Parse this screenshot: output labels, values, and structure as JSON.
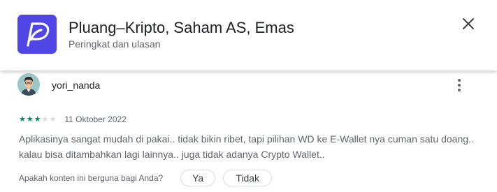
{
  "header": {
    "app_name": "Pluang–Kripto, Saham AS, Emas",
    "subtitle": "Peringkat dan ulasan",
    "icon": "pluang-logo-icon",
    "close_icon": "close-icon"
  },
  "review": {
    "author": "yori_nanda",
    "avatar": "avatar",
    "rating": 3,
    "max_rating": 5,
    "date": "11 Oktober 2022",
    "text": "Aplikasinya sangat mudah di pakai.. tidak bikin ribet, tapi pilihan WD ke E-Wallet nya cuman satu doang.. kalau bisa ditambahkan lagi lainnya.. juga tidak adanya Crypto Wallet..",
    "more_icon": "more-vert-icon",
    "helpful_question": "Apakah konten ini berguna bagi Anda?",
    "yes_label": "Ya",
    "no_label": "Tidak"
  },
  "colors": {
    "app_icon_bg": "#4f46e5",
    "star_filled": "#01875f",
    "star_empty": "#dadce0"
  }
}
